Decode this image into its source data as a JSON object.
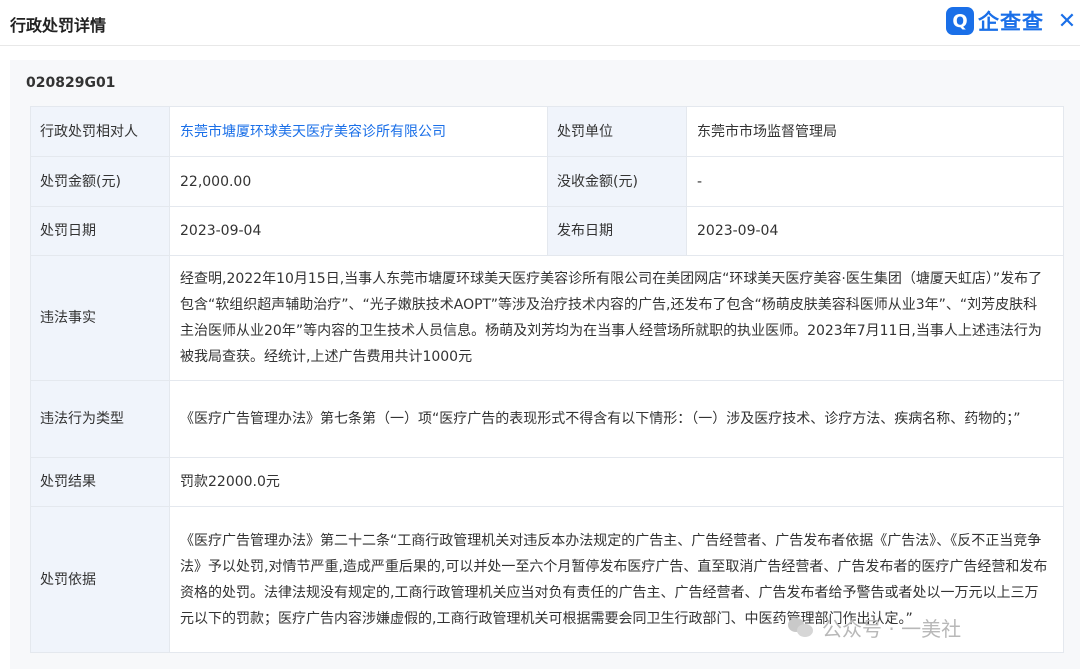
{
  "header": {
    "title": "行政处罚详情",
    "logo_mark": "Q",
    "logo_text": "企查查",
    "close_symbol": "✕"
  },
  "record": {
    "id": "020829G01"
  },
  "fields": {
    "party_label": "行政处罚相对人",
    "party_value": "东莞市塘厦环球美天医疗美容诊所有限公司",
    "authority_label": "处罚单位",
    "authority_value": "东莞市市场监督管理局",
    "fine_label": "处罚金额(元)",
    "fine_value": "22,000.00",
    "confiscation_label": "没收金额(元)",
    "confiscation_value": "-",
    "penalty_date_label": "处罚日期",
    "penalty_date_value": "2023-09-04",
    "publish_date_label": "发布日期",
    "publish_date_value": "2023-09-04",
    "facts_label": "违法事实",
    "facts_value": "经查明,2022年10月15日,当事人东莞市塘厦环球美天医疗美容诊所有限公司在美团网店“环球美天医疗美容·医生集团（塘厦天虹店）”发布了包含“软组织超声辅助治疗”、“光子嫩肤技术AOPT”等涉及治疗技术内容的广告,还发布了包含“杨萌皮肤美容科医师从业3年”、“刘芳皮肤科主治医师从业20年”等内容的卫生技术人员信息。杨萌及刘芳均为在当事人经营场所就职的执业医师。2023年7月11日,当事人上述违法行为被我局查获。经统计,上述广告费用共计1000元",
    "violation_type_label": "违法行为类型",
    "violation_type_value": "《医疗广告管理办法》第七条第（一）项“医疗广告的表现形式不得含有以下情形：（一）涉及医疗技术、诊疗方法、疾病名称、药物的；”",
    "result_label": "处罚结果",
    "result_value": "罚款22000.0元",
    "basis_label": "处罚依据",
    "basis_value": "《医疗广告管理办法》第二十二条“工商行政管理机关对违反本办法规定的广告主、广告经营者、广告发布者依据《广告法》、《反不正当竞争法》予以处罚,对情节严重,造成严重后果的,可以并处一至六个月暂停发布医疗广告、直至取消广告经营者、广告发布者的医疗广告经营和发布资格的处罚。法律法规没有规定的,工商行政管理机关应当对负有责任的广告主、广告经营者、广告发布者给予警告或者处以一万元以上三万元以下的罚款；医疗广告内容涉嫌虚假的,工商行政管理机关可根据需要会同卫生行政部门、中医药管理部门作出认定。”"
  },
  "watermark": {
    "text": "公众号 · 一美社"
  }
}
